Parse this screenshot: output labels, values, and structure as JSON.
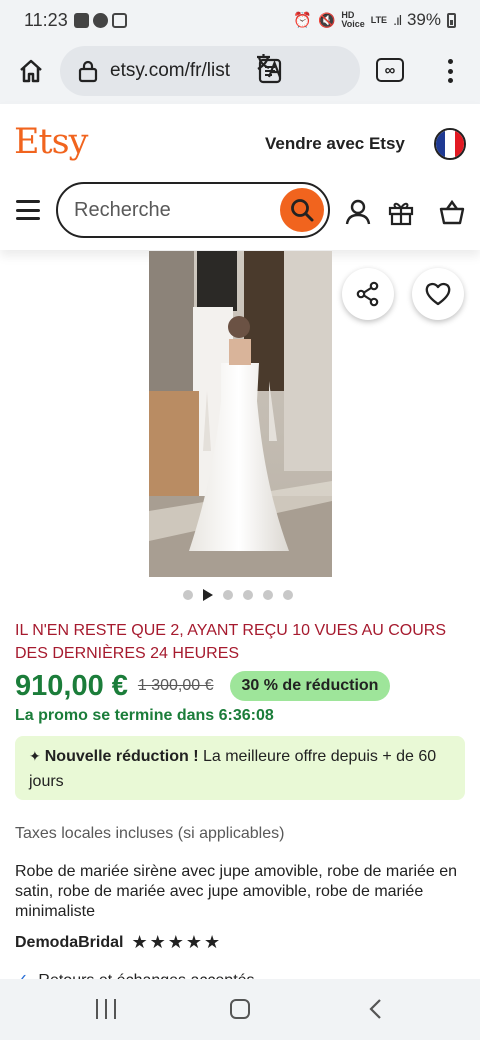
{
  "status_bar": {
    "time": "11:23",
    "network": "LTE",
    "battery": "39%"
  },
  "browser": {
    "url": "etsy.com/fr/list",
    "icons": [
      "home-icon",
      "lock-icon",
      "reader-mode-icon",
      "translate-icon",
      "tabs-icon",
      "more-vert-icon"
    ],
    "tabs_glyph": "∞"
  },
  "header": {
    "logo": "Etsy",
    "sell_link": "Vendre avec Etsy",
    "flag_colors": [
      "#1f3a93",
      "#ffffff",
      "#e21a23"
    ],
    "search_placeholder": "Recherche",
    "icons": [
      "menu-icon",
      "search-icon",
      "user-icon",
      "gift-icon",
      "basket-icon"
    ]
  },
  "gallery": {
    "slide_count": 6,
    "active_slide": 1,
    "active_is_video": true,
    "actions": [
      "share-icon",
      "heart-icon"
    ]
  },
  "product": {
    "scarcity": "IL N'EN RESTE QUE 2, AYANT REÇU 10 VUES AU COURS DES DERNIÈRES 24 HEURES",
    "price": "910,00 €",
    "old_price": "1 300,00 €",
    "discount": "30 % de réduction",
    "promo_end": "La promo se termine dans 6:36:08",
    "new_discount_title": "Nouvelle réduction !",
    "new_discount_text": "La meilleure offre depuis + de 60 jours",
    "taxes": "Taxes locales incluses (si applicables)",
    "title": "Robe de mariée sirène avec jupe amovible, robe de mariée en satin, robe de mariée avec jupe amovible, robe de mariée minimaliste",
    "shop_name": "DemodaBridal",
    "rating_stars": 5,
    "stars_text": "★★★★★",
    "returns": "Retours et échanges acceptés"
  },
  "colors": {
    "brand": "#f1641e",
    "price_green": "#1b7d3a",
    "badge_green": "#9ee59a",
    "scarcity_red": "#a61a2e",
    "promo_bg": "#e9f9d6"
  },
  "nav_bar": {
    "icons": [
      "recents-icon",
      "home-nav-icon",
      "back-icon"
    ]
  }
}
